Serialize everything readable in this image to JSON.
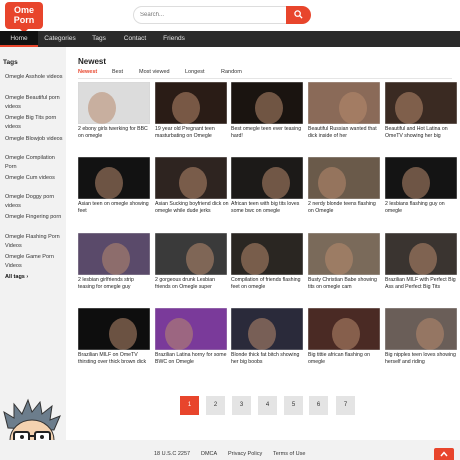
{
  "brand": {
    "line1": "Ome",
    "line2": "Porn"
  },
  "search": {
    "placeholder": "Search..."
  },
  "nav": [
    "Home",
    "Categories",
    "Tags",
    "Contact",
    "Friends"
  ],
  "sidebar": {
    "title": "Tags",
    "items": [
      "Omegle Asshole videos",
      "Omegle Beautiful porn videos",
      "Omegle Big Tits porn videos",
      "Omegle Blowjob videos",
      "Omegle Compilation Porn",
      "Omegle Cum videos",
      "Omegle Doggy porn videos",
      "Omegle Fingering porn",
      "Omegle Flashing Porn Videos",
      "Omegle Game Porn Videos"
    ],
    "all_tags": "All tags ›"
  },
  "main": {
    "title": "Newest",
    "sort": [
      "Newest",
      "Best",
      "Most viewed",
      "Longest",
      "Random"
    ],
    "videos": [
      {
        "title": "2 ebony girls twerking for BBC on omegle",
        "thumb_color": "#dcdcdc"
      },
      {
        "title": "19 year old Pregnant teen masturbating on Omegle",
        "thumb_color": "#2a1c16"
      },
      {
        "title": "Best omegle teen ever teasing hard!",
        "thumb_color": "#1a1410"
      },
      {
        "title": "Beautiful Russian wanted that dick inside of her",
        "thumb_color": "#8a6a58"
      },
      {
        "title": "Beautiful and Hot Latina on OmeTV showing her big",
        "thumb_color": "#3a2a22"
      },
      {
        "title": "Asian teen on omegle showing feet",
        "thumb_color": "#121212"
      },
      {
        "title": "Asian Sucking boyfriend dick on omegle while dude jerks",
        "thumb_color": "#2e2420"
      },
      {
        "title": "African teen with big tits loves some bwc on omegle",
        "thumb_color": "#1c1a18"
      },
      {
        "title": "2 nerdy blonde teens flashing on Omegle",
        "thumb_color": "#6a5a4a"
      },
      {
        "title": "2 lesbians flashing guy on omegle",
        "thumb_color": "#141414"
      },
      {
        "title": "2 lesbian girlfriends strip teasing for omegle guy",
        "thumb_color": "#5a4a6a"
      },
      {
        "title": "2 gorgeous drunk Lesbian friends on Omegle super",
        "thumb_color": "#3a3a3a"
      },
      {
        "title": "Compilation of friends flashing feet on omegle",
        "thumb_color": "#2a2622"
      },
      {
        "title": "Busty Christian Babe showing tits on omegle cam",
        "thumb_color": "#7a6a5a"
      },
      {
        "title": "Brazilian MILF with Perfect Big Ass and Perfect Big Tits",
        "thumb_color": "#3a3430"
      },
      {
        "title": "Brazilian MILF on OmeTV thirsting over thick brown dick",
        "thumb_color": "#0e0e0e"
      },
      {
        "title": "Brazilian Latina horny for some BWC on Omegle",
        "thumb_color": "#7a3a9a"
      },
      {
        "title": "Blonde thick fat bitch showing her big boobs",
        "thumb_color": "#2a2a3a"
      },
      {
        "title": "Big tittie african flashing on omegle",
        "thumb_color": "#4a2a24"
      },
      {
        "title": "Big nipples teen loves showing herself and riding",
        "thumb_color": "#6a5e58"
      }
    ],
    "pages": [
      "1",
      "2",
      "3",
      "4",
      "5",
      "6",
      "7"
    ]
  },
  "footer": {
    "links": [
      "18 U.S.C 2257",
      "DMCA",
      "Privacy Policy",
      "Terms of Use"
    ]
  },
  "colors": {
    "accent": "#e8452c",
    "nav_bg": "#2b2b2b",
    "page_bg": "#f2f2f2"
  }
}
